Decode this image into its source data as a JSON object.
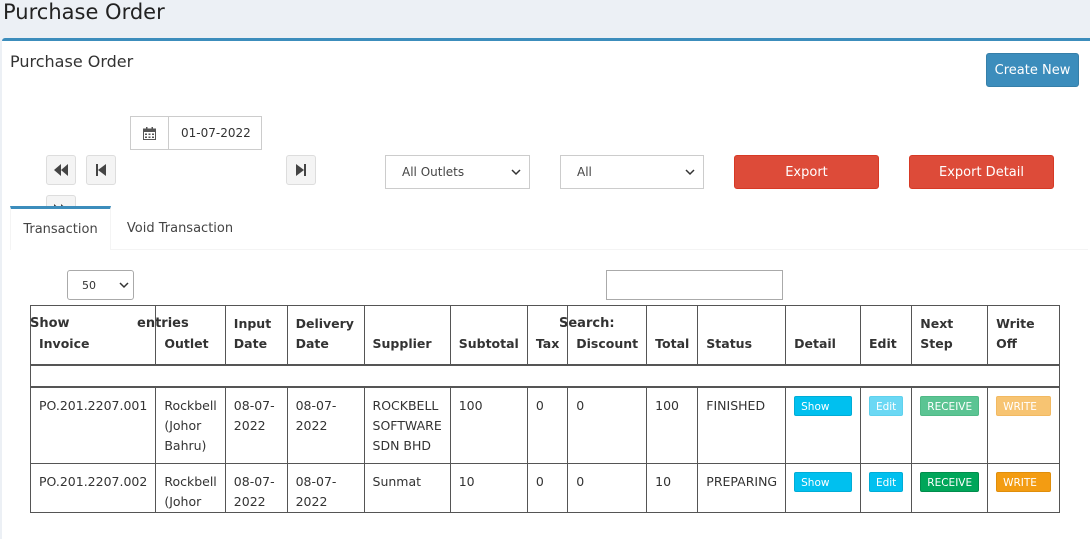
{
  "page": {
    "title": "Purchase Order"
  },
  "box": {
    "title": "Purchase Order",
    "create_label": "Create New"
  },
  "filters": {
    "date_value": "01-07-2022",
    "outlet_selected": "All Outlets",
    "status_selected": "All",
    "export_label": "Export",
    "export_detail_label": "Export Detail"
  },
  "tabs": [
    {
      "label": "Transaction",
      "active": true
    },
    {
      "label": "Void Transaction",
      "active": false
    }
  ],
  "table_controls": {
    "show_label": "Show",
    "length_selected": "50",
    "entries_label": "entries",
    "search_label": "Search:"
  },
  "table": {
    "headers": {
      "invoice": "Invoice",
      "outlet": "Outlet",
      "input_date_1": "Input",
      "input_date_2": "Date",
      "delivery_date_1": "Delivery",
      "delivery_date_2": "Date",
      "supplier": "Supplier",
      "subtotal": "Subtotal",
      "tax": "Tax",
      "discount": "Discount",
      "total": "Total",
      "status": "Status",
      "detail": "Detail",
      "edit": "Edit",
      "next_step_1": "Next",
      "next_step_2": "Step",
      "write_off": "Write Off"
    },
    "rows": [
      {
        "invoice": "PO.201.2207.001",
        "outlet_1": "Rockbell",
        "outlet_2": "(Johor",
        "outlet_3": "Bahru)",
        "input_date": "08-07-2022",
        "delivery_date": "08-07-2022",
        "supplier_1": "ROCKBELL",
        "supplier_2": "SOFTWARE",
        "supplier_3": "SDN BHD",
        "subtotal": "100",
        "tax": "0",
        "discount": "0",
        "total": "100",
        "status": "FINISHED",
        "detail_label": "Show Details",
        "edit_label": "Edit",
        "next_label": "RECEIVE",
        "writeoff_label": "WRITE OFF"
      },
      {
        "invoice": "PO.201.2207.002",
        "outlet_1": "Rockbell",
        "outlet_2": "(Johor",
        "input_date": "08-07-2022",
        "delivery_date": "08-07-2022",
        "supplier_1": "Sunmat",
        "subtotal": "10",
        "tax": "0",
        "discount": "0",
        "total": "10",
        "status": "PREPARING",
        "detail_label": "Show Details",
        "edit_label": "Edit",
        "next_label": "RECEIVE",
        "writeoff_label": "WRITE OFF"
      }
    ]
  },
  "colors": {
    "primary": "#3c8dbc",
    "danger": "#dd4b39",
    "info": "#00c0ef",
    "success": "#00a65a",
    "warning": "#f39c12"
  }
}
